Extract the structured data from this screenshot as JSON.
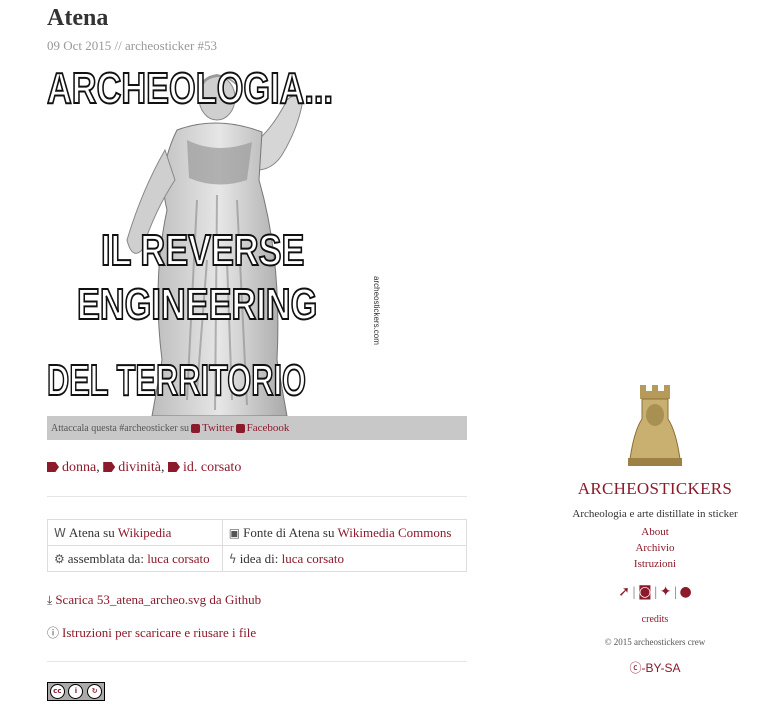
{
  "post": {
    "title": "Atena",
    "meta": "09 Oct 2015 // archeosticker #53"
  },
  "sticker": {
    "line1": "ARCHEOLOGIA...",
    "line2": "IL REVERSE",
    "line3": "ENGINEERING",
    "line4": "DEL TERRITORIO",
    "vertical_text": "archeostickers.com"
  },
  "share": {
    "text": "Attaccala questa #archeosticker su",
    "twitter": "Twitter",
    "facebook": "Facebook"
  },
  "tags": [
    {
      "label": "donna",
      "sep": ","
    },
    {
      "label": "divinità",
      "sep": ","
    },
    {
      "label": "id. corsato",
      "sep": ""
    }
  ],
  "info": {
    "wiki_prefix": "Atena su",
    "wiki_link": "Wikipedia",
    "source_prefix": "Fonte di Atena su",
    "source_link": "Wikimedia Commons",
    "assembled_prefix": "assemblata da:",
    "assembled_link": "luca corsato",
    "idea_prefix": "idea di:",
    "idea_link": "luca corsato"
  },
  "downloads": {
    "svg": "Scarica 53_atena_archeo.svg da Github",
    "instructions": "Istruzioni per scaricare e riusare i file"
  },
  "sidebar": {
    "title": "ARCHEOSTICKERS",
    "description": "Archeologia e arte distillate in sticker",
    "links": [
      "About",
      "Archivio",
      "Istruzioni"
    ],
    "credits": "credits",
    "copyright": "© 2015 archeostickers crew",
    "license": "-BY-SA"
  },
  "colors": {
    "accent": "#8b1a2b",
    "share_bar": "#c8c8c8"
  }
}
